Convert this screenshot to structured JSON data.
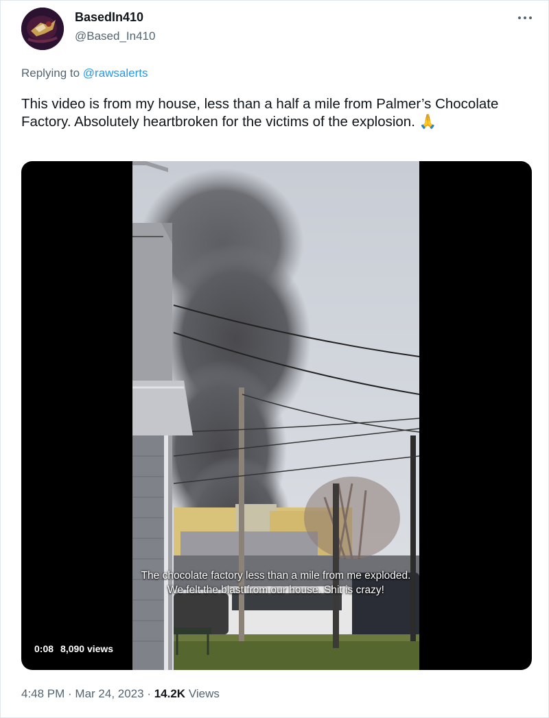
{
  "tweet": {
    "author": {
      "display_name": "BasedIn410",
      "handle": "@Based_In410",
      "avatar_icon": "avatar-image"
    },
    "more_icon": "ellipsis-icon",
    "reply": {
      "prefix": "Replying to ",
      "to_handle": "@rawsalerts"
    },
    "text": "This video is from my house, less than a half a mile from Palmer’s Chocolate Factory. Absolutely heartbroken for the victims of the explosion. 🙏",
    "media": {
      "type": "video",
      "subtitle": "The chocolate factory less than a mile from me exploded. We felt the blast from our house. Shit is crazy!",
      "timestamp": "0:08",
      "views": "8,090 views"
    },
    "footer": {
      "time": "4:48 PM",
      "separator": " · ",
      "date": "Mar 24, 2023",
      "separator2": " · ",
      "views_count": "14.2K",
      "views_label": " Views"
    }
  },
  "colors": {
    "link": "#1d9bf0",
    "secondary_text": "#536471",
    "primary_text": "#0f1419",
    "media_background": "#000000"
  }
}
